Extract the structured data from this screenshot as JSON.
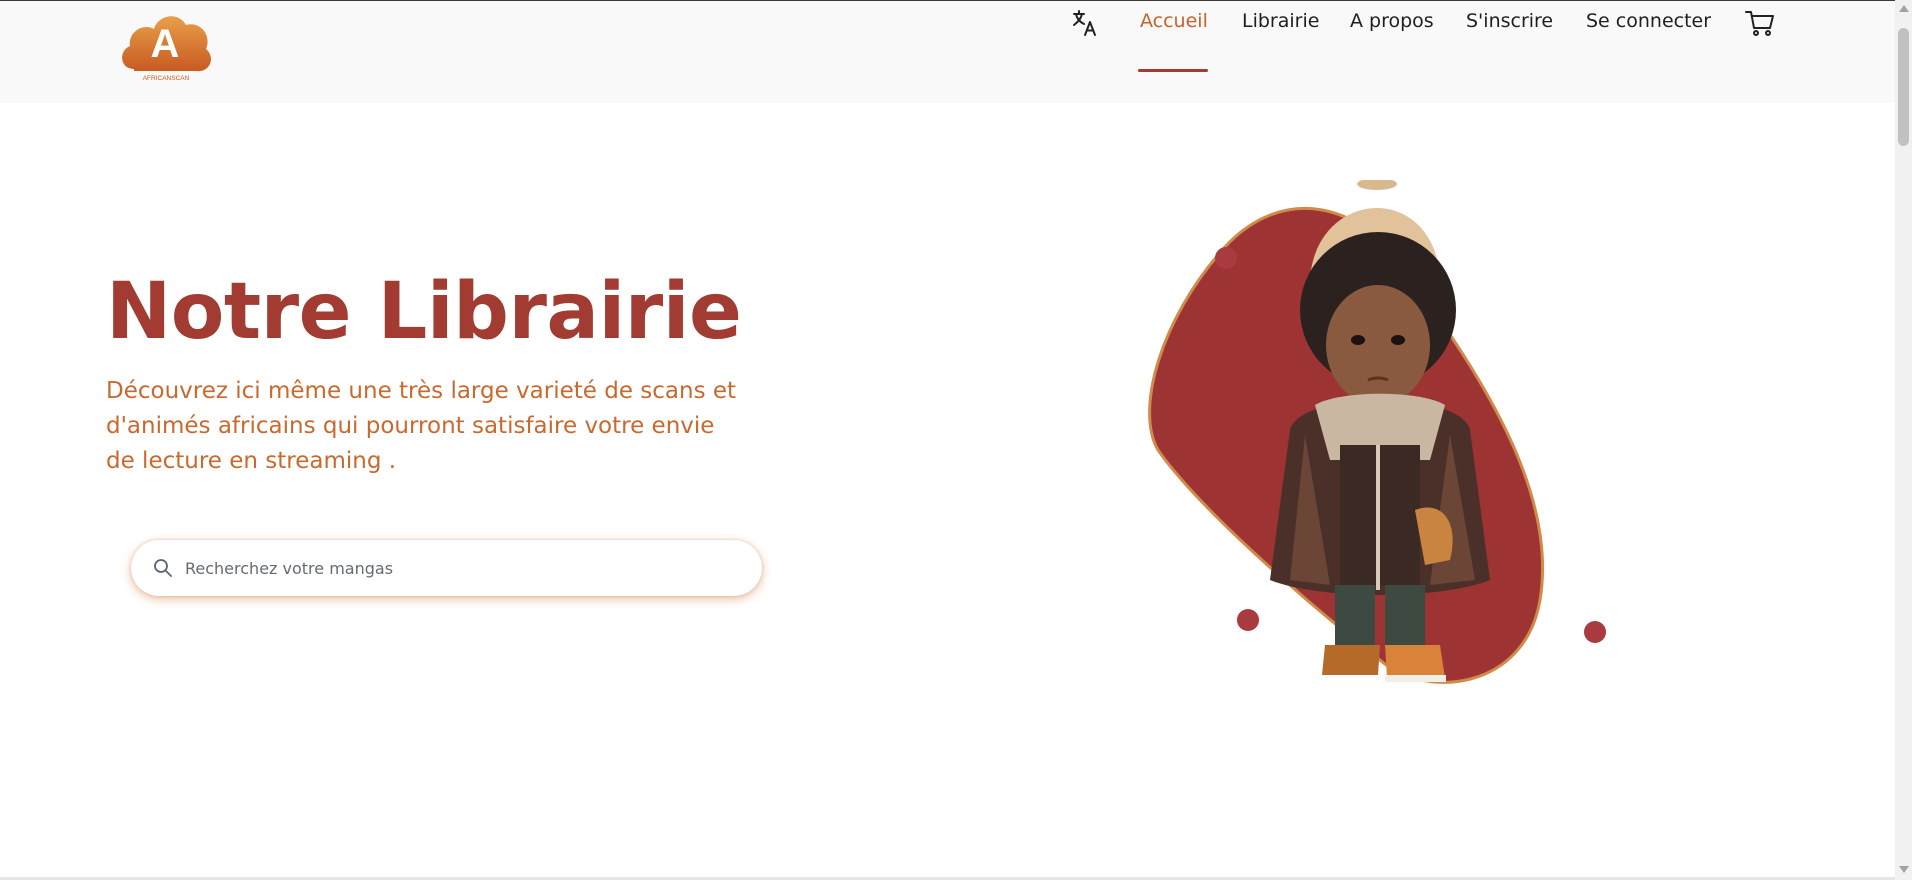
{
  "header": {
    "logo": {
      "letter": "A",
      "brand": "AFRICANSCAN",
      "colors": [
        "#e8a04a",
        "#c85a22"
      ]
    },
    "translate_icon": "translate-icon",
    "cart_icon": "cart-icon",
    "nav": [
      {
        "label": "Accueil",
        "active": true
      },
      {
        "label": "Librairie",
        "active": false
      },
      {
        "label": "A propos",
        "active": false
      },
      {
        "label": "S'inscrire",
        "active": false
      },
      {
        "label": "Se connecter",
        "active": false
      }
    ]
  },
  "hero": {
    "title": "Notre Librairie",
    "description": "Découvrez ici même une très large varieté de scans et d'animés africains qui pourront satisfaire votre envie de lecture en streaming ."
  },
  "search": {
    "icon": "search-icon",
    "placeholder": "Recherchez votre mangas",
    "value": ""
  },
  "colors": {
    "accent": "#c8612c",
    "title": "#a23b31",
    "description": "#c8692e",
    "blob": "#9e3333"
  }
}
